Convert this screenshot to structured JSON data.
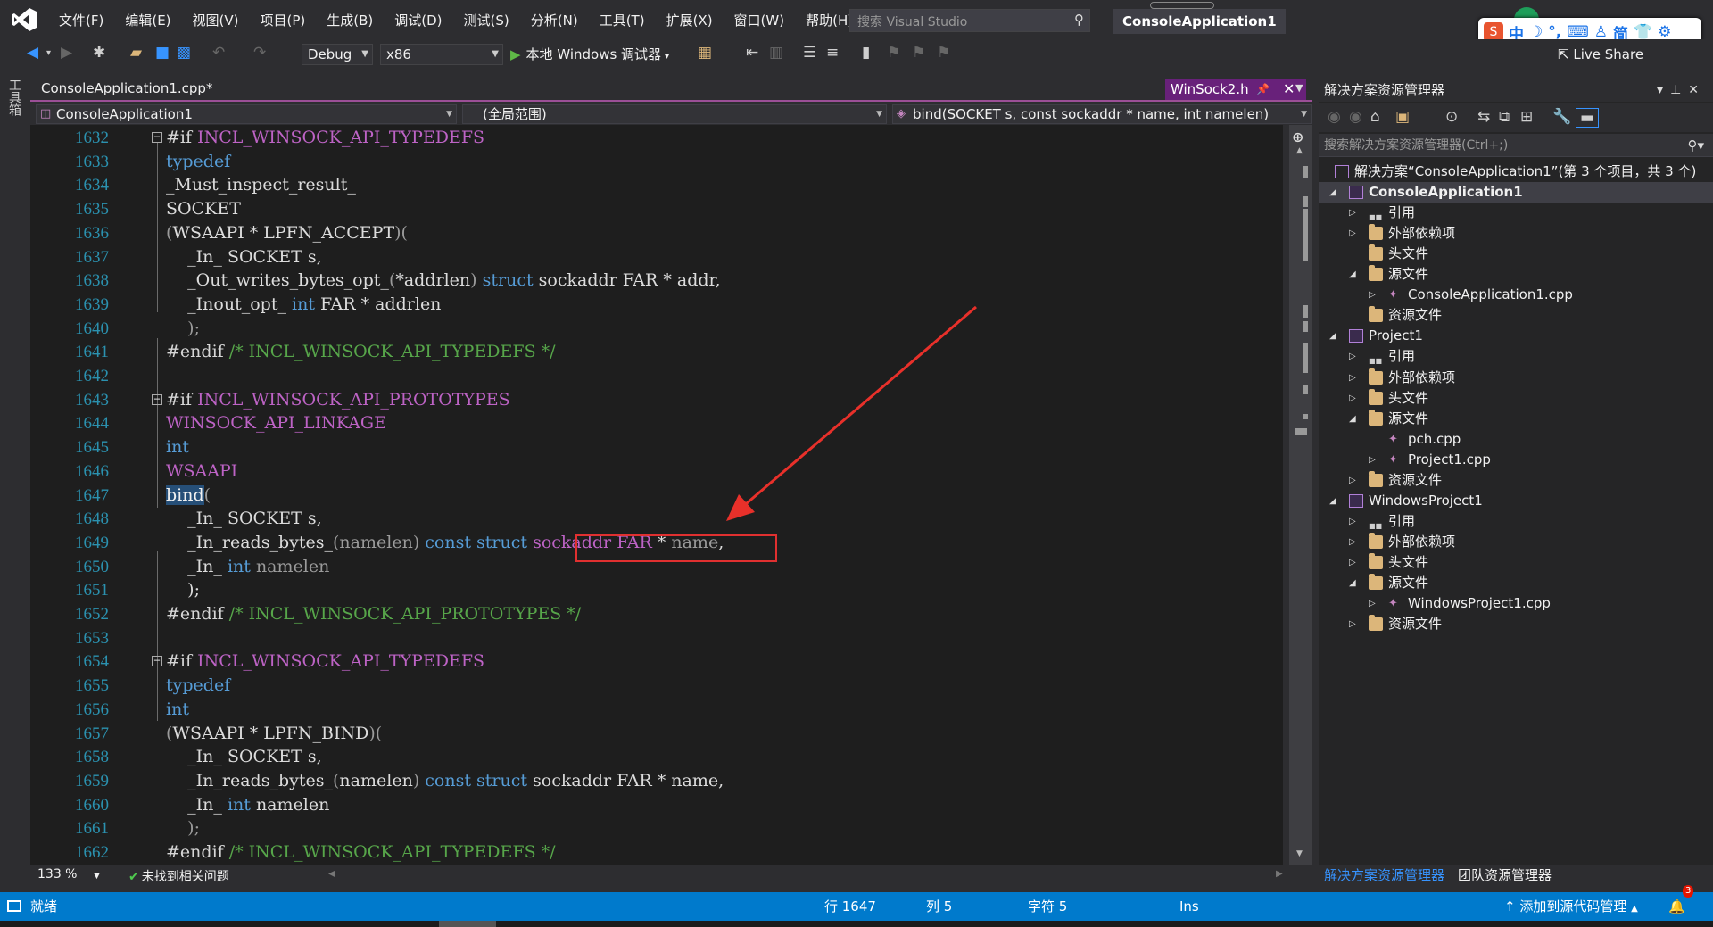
{
  "menu": [
    "文件(F)",
    "编辑(E)",
    "视图(V)",
    "项目(P)",
    "生成(B)",
    "调试(D)",
    "测试(S)",
    "分析(N)",
    "工具(T)",
    "扩展(X)",
    "窗口(W)",
    "帮助(H)"
  ],
  "search": {
    "placeholder": "搜索 Visual Studio"
  },
  "solution_title": "ConsoleApplication1",
  "ime": {
    "mode": "中",
    "simplified": "简"
  },
  "toolbar": {
    "config": "Debug",
    "platform": "x86",
    "run_label": "本地 Windows 调试器",
    "live_share": "Live Share"
  },
  "left_strip": {
    "toolbox": "工具箱"
  },
  "tabs": {
    "inactive": "ConsoleApplication1.cpp*",
    "active": "WinSock2.h"
  },
  "navbar": {
    "project": "ConsoleApplication1",
    "scope": "(全局范围)",
    "member": "bind(SOCKET s, const sockaddr * name, int namelen)"
  },
  "code": [
    {
      "n": "1632",
      "fold": true,
      "segs": [
        [
          "pp",
          "#if "
        ],
        [
          "mac",
          "INCL_WINSOCK_API_TYPEDEFS"
        ]
      ]
    },
    {
      "n": "1633",
      "segs": [
        [
          "kw",
          "typedef"
        ]
      ]
    },
    {
      "n": "1634",
      "segs": [
        [
          "id",
          "_Must_inspect_result_"
        ]
      ]
    },
    {
      "n": "1635",
      "segs": [
        [
          "id",
          "SOCKET"
        ]
      ]
    },
    {
      "n": "1636",
      "segs": [
        [
          "par",
          "("
        ],
        [
          "id",
          "WSAAPI * LPFN_ACCEPT"
        ],
        [
          "par",
          ")("
        ]
      ]
    },
    {
      "n": "1637",
      "segs": [
        [
          "id",
          "    _In_ SOCKET s,"
        ]
      ]
    },
    {
      "n": "1638",
      "segs": [
        [
          "id",
          "    _Out_writes_bytes_opt_"
        ],
        [
          "par",
          "("
        ],
        [
          "id",
          "*addrlen"
        ],
        [
          "par",
          ")"
        ],
        [
          "id",
          " "
        ],
        [
          "kw",
          "struct"
        ],
        [
          "id",
          " sockaddr FAR * addr,"
        ]
      ]
    },
    {
      "n": "1639",
      "segs": [
        [
          "id",
          "    _Inout_opt_ "
        ],
        [
          "kw",
          "int"
        ],
        [
          "id",
          " FAR * addrlen"
        ]
      ]
    },
    {
      "n": "1640",
      "segs": [
        [
          "par",
          "    );"
        ]
      ]
    },
    {
      "n": "1641",
      "segs": [
        [
          "pp",
          "#endif "
        ],
        [
          "cm",
          "/* INCL_WINSOCK_API_TYPEDEFS */"
        ]
      ]
    },
    {
      "n": "1642",
      "segs": []
    },
    {
      "n": "1643",
      "fold": true,
      "segs": [
        [
          "pp",
          "#if "
        ],
        [
          "mac",
          "INCL_WINSOCK_API_PROTOTYPES"
        ]
      ]
    },
    {
      "n": "1644",
      "segs": [
        [
          "mac",
          "WINSOCK_API_LINKAGE"
        ]
      ]
    },
    {
      "n": "1645",
      "segs": [
        [
          "kw",
          "int"
        ]
      ]
    },
    {
      "n": "1646",
      "segs": [
        [
          "mac",
          "WSAAPI"
        ]
      ]
    },
    {
      "n": "1647",
      "segs": [
        [
          "hl",
          "bind"
        ],
        [
          "par",
          "("
        ]
      ]
    },
    {
      "n": "1648",
      "segs": [
        [
          "id",
          "    _In_ SOCKET s,"
        ]
      ]
    },
    {
      "n": "1649",
      "segs": [
        [
          "id",
          "    _In_reads_bytes_"
        ],
        [
          "par",
          "("
        ],
        [
          "par",
          "namelen"
        ],
        [
          "par",
          ")"
        ],
        [
          "id",
          " "
        ],
        [
          "kw",
          "const struct"
        ],
        [
          "id",
          " "
        ],
        [
          "mac",
          "sockaddr"
        ],
        [
          "id",
          " "
        ],
        [
          "mac",
          "FAR"
        ],
        [
          "id",
          " * "
        ],
        [
          "par",
          "name"
        ],
        [
          "id",
          ","
        ]
      ]
    },
    {
      "n": "1650",
      "segs": [
        [
          "id",
          "    _In_ "
        ],
        [
          "kw",
          "int"
        ],
        [
          "par",
          " namelen"
        ]
      ]
    },
    {
      "n": "1651",
      "segs": [
        [
          "id",
          "    );"
        ]
      ]
    },
    {
      "n": "1652",
      "segs": [
        [
          "pp",
          "#endif "
        ],
        [
          "cm",
          "/* INCL_WINSOCK_API_PROTOTYPES */"
        ]
      ]
    },
    {
      "n": "1653",
      "segs": []
    },
    {
      "n": "1654",
      "fold": true,
      "segs": [
        [
          "pp",
          "#if "
        ],
        [
          "mac",
          "INCL_WINSOCK_API_TYPEDEFS"
        ]
      ]
    },
    {
      "n": "1655",
      "segs": [
        [
          "kw",
          "typedef"
        ]
      ]
    },
    {
      "n": "1656",
      "segs": [
        [
          "kw",
          "int"
        ]
      ]
    },
    {
      "n": "1657",
      "segs": [
        [
          "par",
          "("
        ],
        [
          "id",
          "WSAAPI * LPFN_BIND"
        ],
        [
          "par",
          ")("
        ]
      ]
    },
    {
      "n": "1658",
      "segs": [
        [
          "id",
          "    _In_ SOCKET s,"
        ]
      ]
    },
    {
      "n": "1659",
      "segs": [
        [
          "id",
          "    _In_reads_bytes_"
        ],
        [
          "par",
          "("
        ],
        [
          "id",
          "namelen"
        ],
        [
          "par",
          ")"
        ],
        [
          "id",
          " "
        ],
        [
          "kw",
          "const struct"
        ],
        [
          "id",
          " sockaddr FAR * name,"
        ]
      ]
    },
    {
      "n": "1660",
      "segs": [
        [
          "id",
          "    _In_ "
        ],
        [
          "kw",
          "int"
        ],
        [
          "id",
          " namelen"
        ]
      ]
    },
    {
      "n": "1661",
      "segs": [
        [
          "par",
          "    );"
        ]
      ]
    },
    {
      "n": "1662",
      "segs": [
        [
          "pp",
          "#endif "
        ],
        [
          "cm",
          "/* INCL_WINSOCK_API_TYPEDEFS */"
        ]
      ]
    }
  ],
  "editor_bottom": {
    "zoom": "133 %",
    "issues": "未找到相关问题"
  },
  "solution_explorer": {
    "title": "解决方案资源管理器",
    "search_placeholder": "搜索解决方案资源管理器(Ctrl+;)",
    "tree": [
      {
        "label": "解决方案“ConsoleApplication1”(第 3 个项目，共 3 个)",
        "indent": 0,
        "icon": "sln",
        "exp": ""
      },
      {
        "label": "ConsoleApplication1",
        "indent": 0,
        "icon": "proj",
        "exp": "◢",
        "selected": true
      },
      {
        "label": "引用",
        "indent": 1,
        "icon": "ref",
        "exp": "▷"
      },
      {
        "label": "外部依赖项",
        "indent": 1,
        "icon": "folder",
        "exp": "▷"
      },
      {
        "label": "头文件",
        "indent": 1,
        "icon": "folder",
        "exp": ""
      },
      {
        "label": "源文件",
        "indent": 1,
        "icon": "folder",
        "exp": "◢"
      },
      {
        "label": "ConsoleApplication1.cpp",
        "indent": 2,
        "icon": "cpp",
        "exp": "▷"
      },
      {
        "label": "资源文件",
        "indent": 1,
        "icon": "folder",
        "exp": ""
      },
      {
        "label": "Project1",
        "indent": 0,
        "icon": "proj",
        "exp": "◢"
      },
      {
        "label": "引用",
        "indent": 1,
        "icon": "ref",
        "exp": "▷"
      },
      {
        "label": "外部依赖项",
        "indent": 1,
        "icon": "folder",
        "exp": "▷"
      },
      {
        "label": "头文件",
        "indent": 1,
        "icon": "folder",
        "exp": "▷"
      },
      {
        "label": "源文件",
        "indent": 1,
        "icon": "folder",
        "exp": "◢"
      },
      {
        "label": "pch.cpp",
        "indent": 2,
        "icon": "cpp",
        "exp": ""
      },
      {
        "label": "Project1.cpp",
        "indent": 2,
        "icon": "cpp",
        "exp": "▷"
      },
      {
        "label": "资源文件",
        "indent": 1,
        "icon": "folder",
        "exp": "▷"
      },
      {
        "label": "WindowsProject1",
        "indent": 0,
        "icon": "proj",
        "exp": "◢"
      },
      {
        "label": "引用",
        "indent": 1,
        "icon": "ref",
        "exp": "▷"
      },
      {
        "label": "外部依赖项",
        "indent": 1,
        "icon": "folder",
        "exp": "▷"
      },
      {
        "label": "头文件",
        "indent": 1,
        "icon": "folder",
        "exp": "▷"
      },
      {
        "label": "源文件",
        "indent": 1,
        "icon": "folder",
        "exp": "◢"
      },
      {
        "label": "WindowsProject1.cpp",
        "indent": 2,
        "icon": "cpp",
        "exp": "▷"
      },
      {
        "label": "资源文件",
        "indent": 1,
        "icon": "folder",
        "exp": "▷"
      }
    ],
    "tab_active": "解决方案资源管理器",
    "tab_team": "团队资源管理器"
  },
  "statusbar": {
    "ready": "就绪",
    "line": "行 1647",
    "col": "列 5",
    "char": "字符 5",
    "ins": "Ins",
    "source_control": "添加到源代码管理",
    "notifications": "3"
  },
  "colors": {
    "accent_tab": "#68217a",
    "statusbar": "#007acc",
    "annotation": "#e03030",
    "editor_bg": "#1e1e1e"
  }
}
